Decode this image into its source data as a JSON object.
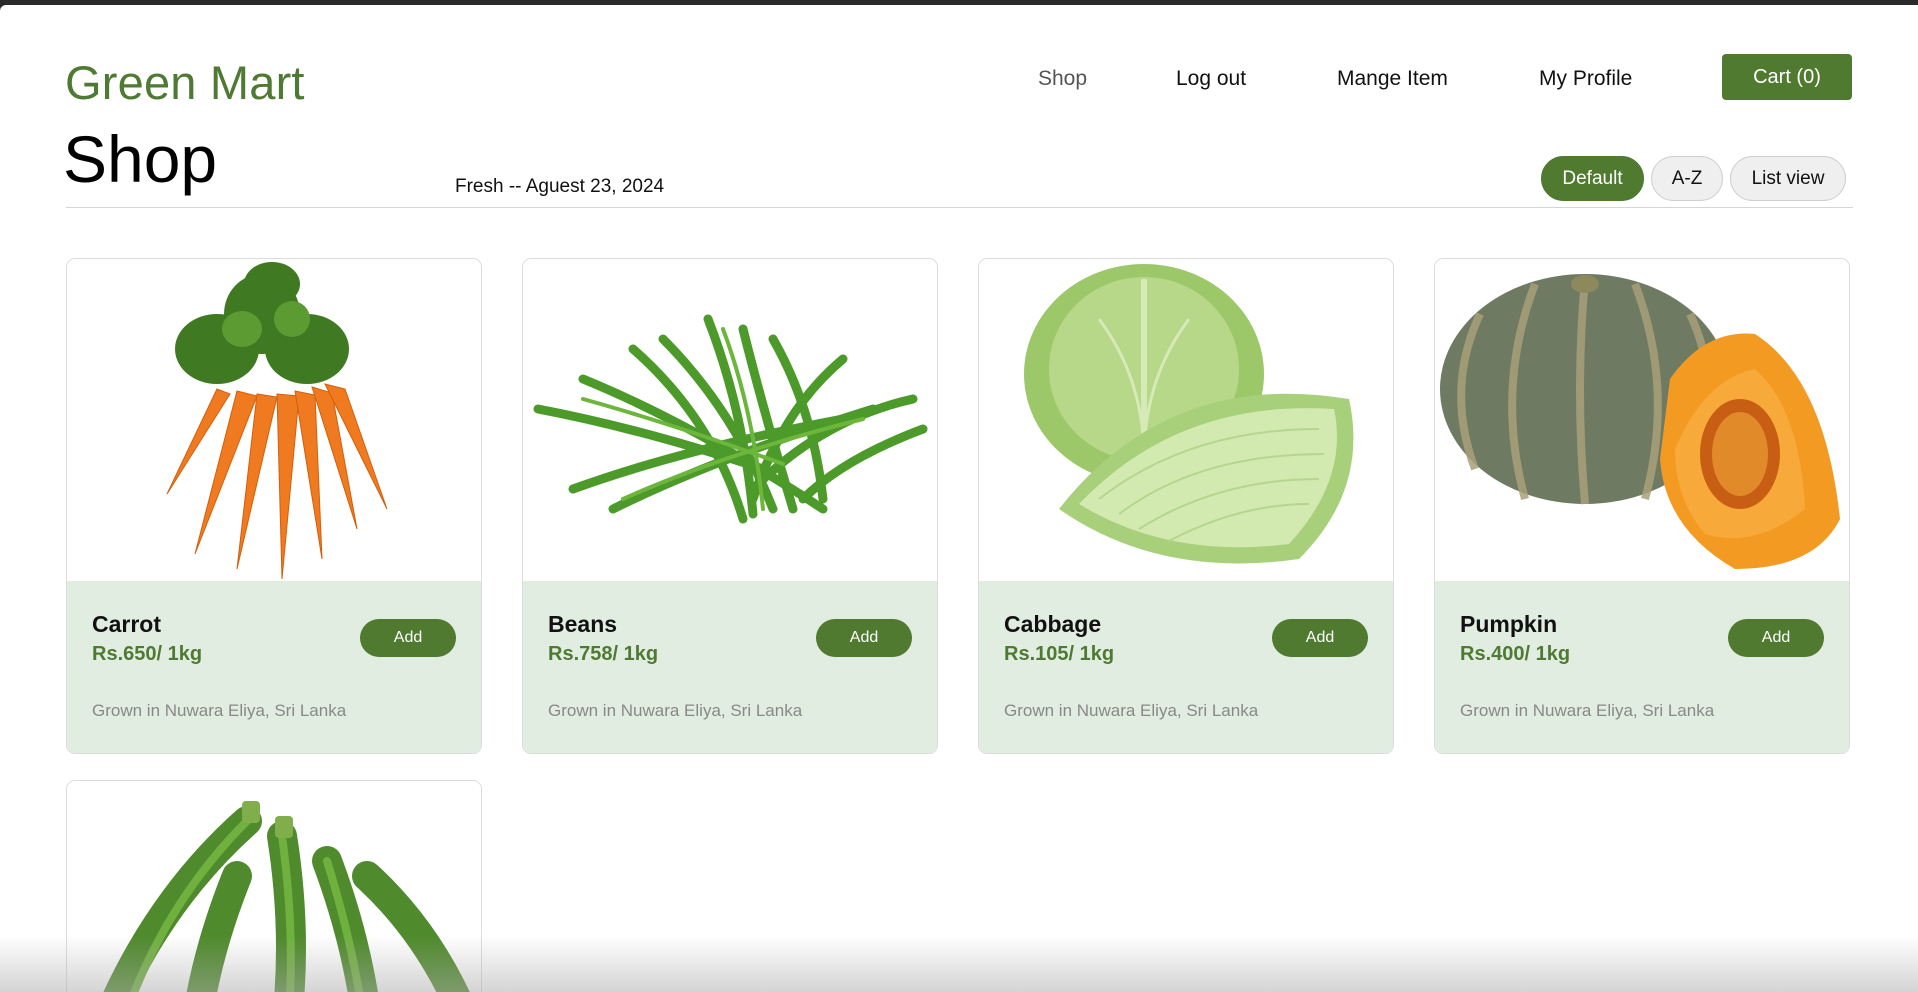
{
  "header": {
    "brand": "Green Mart",
    "nav": {
      "shop": "Shop",
      "logout": "Log out",
      "manage": "Mange Item",
      "profile": "My Profile"
    },
    "cart_label": "Cart (0)"
  },
  "page": {
    "title": "Shop",
    "subtitle": "Fresh -- Aguest 23, 2024",
    "sort_options": {
      "default": "Default",
      "az": "A-Z",
      "list": "List view"
    },
    "active_sort": "Default"
  },
  "colors": {
    "brand_green": "#4f7a2f",
    "card_info_bg": "#e1ede0",
    "price_green": "#4f7a33"
  },
  "products": [
    {
      "name": "Carrot",
      "price": "Rs.650/ 1kg",
      "origin": "Grown in Nuwara Eliya, Sri Lanka",
      "add_label": "Add",
      "icon": "carrot-image"
    },
    {
      "name": "Beans",
      "price": "Rs.758/ 1kg",
      "origin": "Grown in Nuwara Eliya, Sri Lanka",
      "add_label": "Add",
      "icon": "beans-image"
    },
    {
      "name": "Cabbage",
      "price": "Rs.105/ 1kg",
      "origin": "Grown in Nuwara Eliya, Sri Lanka",
      "add_label": "Add",
      "icon": "cabbage-image"
    },
    {
      "name": "Pumpkin",
      "price": "Rs.400/ 1kg",
      "origin": "Grown in Nuwara Eliya, Sri Lanka",
      "add_label": "Add",
      "icon": "pumpkin-image"
    },
    {
      "icon": "okra-image"
    }
  ]
}
